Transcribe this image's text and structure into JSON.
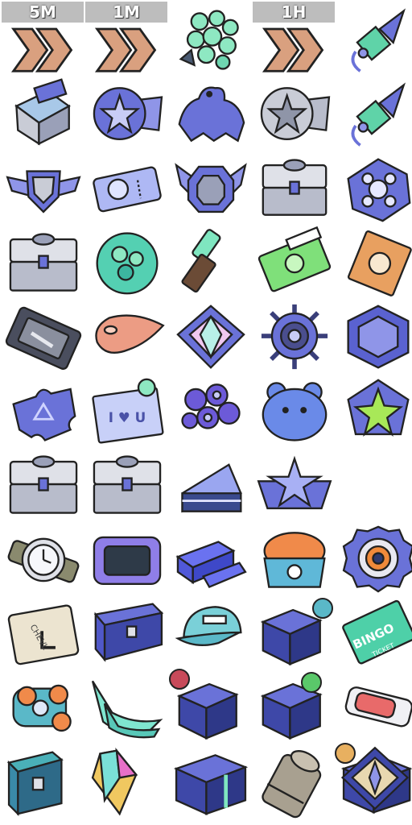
{
  "timers": {
    "t1": "5M",
    "t2": "1M",
    "t3": "1H"
  },
  "labels": {
    "cheval": "CHEVL",
    "bingo": "BINGO",
    "bingo_sub": "TICKET",
    "love": "I ♥ U"
  },
  "colors": {
    "chevron": "#d9a07f",
    "blue": "#6a72d8",
    "mint": "#7fe6c0",
    "silver": "#c9ccd6",
    "outline": "#222222"
  },
  "grid": {
    "columns": 5,
    "rows": [
      [
        "chevron-rank",
        "chevron-rank",
        "mint-rose-bouquet",
        "chevron-rank",
        "firework-rocket"
      ],
      [
        "silver-open-crate",
        "blue-star-badge",
        "blue-tiger-statue",
        "silver-star-badge",
        "firework-rocket"
      ],
      [
        "winged-shield-emblem",
        "blue-ticket",
        "winged-frame-emblem",
        "silver-chest",
        "blue-flower-tile"
      ],
      [
        "silver-chest",
        "green-pom-pom",
        "lipstick",
        "green-cash-note",
        "orange-fist-card"
      ],
      [
        "tool-case",
        "salmon-tear-drop",
        "prism-diamond-emblem",
        "ship-wheel",
        "blue-hex-gem"
      ],
      [
        "blue-glow-puzzle",
        "love-letter-card",
        "violet-flower-cluster",
        "blue-bear-cookie",
        "green-star-crystal"
      ],
      [
        "silver-chest",
        "silver-chest",
        "blue-layer-cake",
        "star-emblem",
        "empty"
      ],
      [
        "silver-wristwatch",
        "purple-frame-mirror",
        "blue-ingot-bars",
        "orange-gem-cashbox",
        "target-gear-token"
      ],
      [
        "cheval-card",
        "treasure-chest",
        "blue-cap",
        "blue-mystery-box",
        "bingo-ticket"
      ],
      [
        "orange-gem-bracelet",
        "mint-crystal-heels",
        "blue-mystery-box",
        "blue-mystery-box",
        "red-jelly-tube"
      ],
      [
        "teal-chest",
        "rainbow-crystal",
        "blue-mystery-box",
        "metal-barrel",
        "blue-mystery-box"
      ]
    ]
  }
}
